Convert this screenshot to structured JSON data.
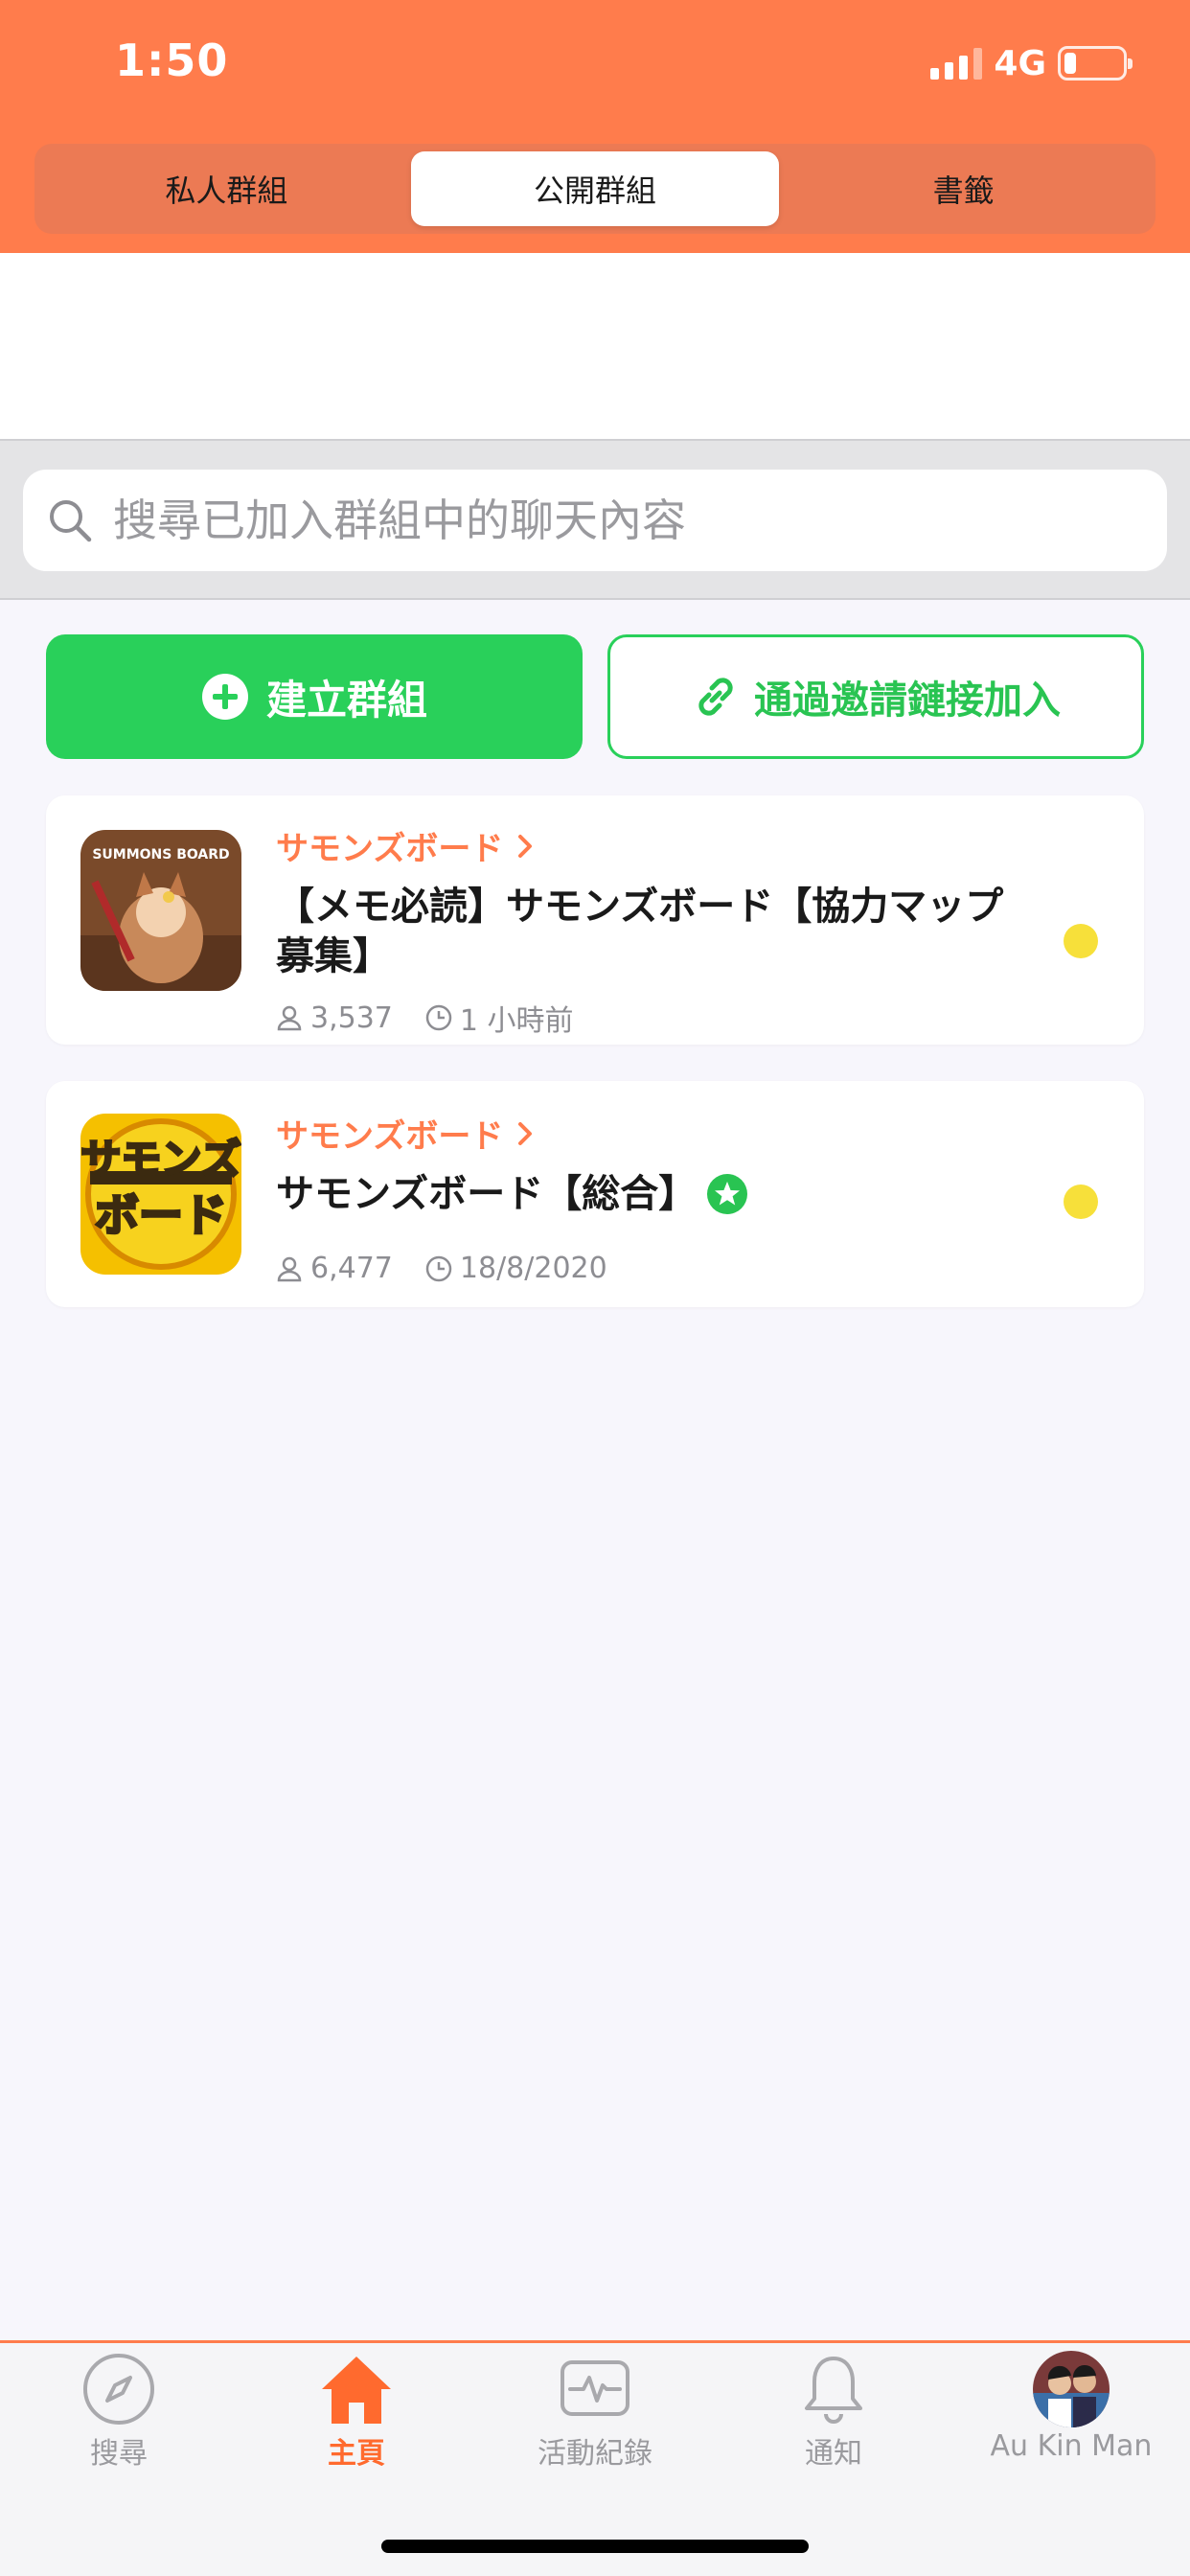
{
  "status_bar": {
    "time": "1:50",
    "network": "4G",
    "battery_level": 0.2
  },
  "segments": [
    {
      "label": "私人群組",
      "active": false
    },
    {
      "label": "公開群組",
      "active": true
    },
    {
      "label": "書籤",
      "active": false
    }
  ],
  "search": {
    "placeholder": "搜尋已加入群組中的聊天內容"
  },
  "actions": {
    "create_label": "建立群組",
    "join_label": "通過邀請鏈接加入"
  },
  "groups": [
    {
      "source": "サモンズボード",
      "title": "【メモ必読】サモンズボード【協力マップ募集】",
      "members": "3,537",
      "time": "1 小時前",
      "verified": false,
      "thumb_text": "SUMMONS BOARD"
    },
    {
      "source": "サモンズボード",
      "title": "サモンズボード【総合】",
      "members": "6,477",
      "time": "18/8/2020",
      "verified": true,
      "thumb_text_top": "サモンズ",
      "thumb_text_bottom": "ボード"
    }
  ],
  "tabbar": [
    {
      "label": "搜尋",
      "icon": "compass-icon",
      "active": false
    },
    {
      "label": "主頁",
      "icon": "home-icon",
      "active": true
    },
    {
      "label": "活動紀錄",
      "icon": "activity-icon",
      "active": false
    },
    {
      "label": "通知",
      "icon": "bell-icon",
      "active": false
    },
    {
      "label": "Au Kin Man",
      "icon": "avatar",
      "active": false
    }
  ],
  "colors": {
    "brand": "#ff7c4c",
    "green": "#29d05a",
    "dot": "#f7e03a"
  }
}
